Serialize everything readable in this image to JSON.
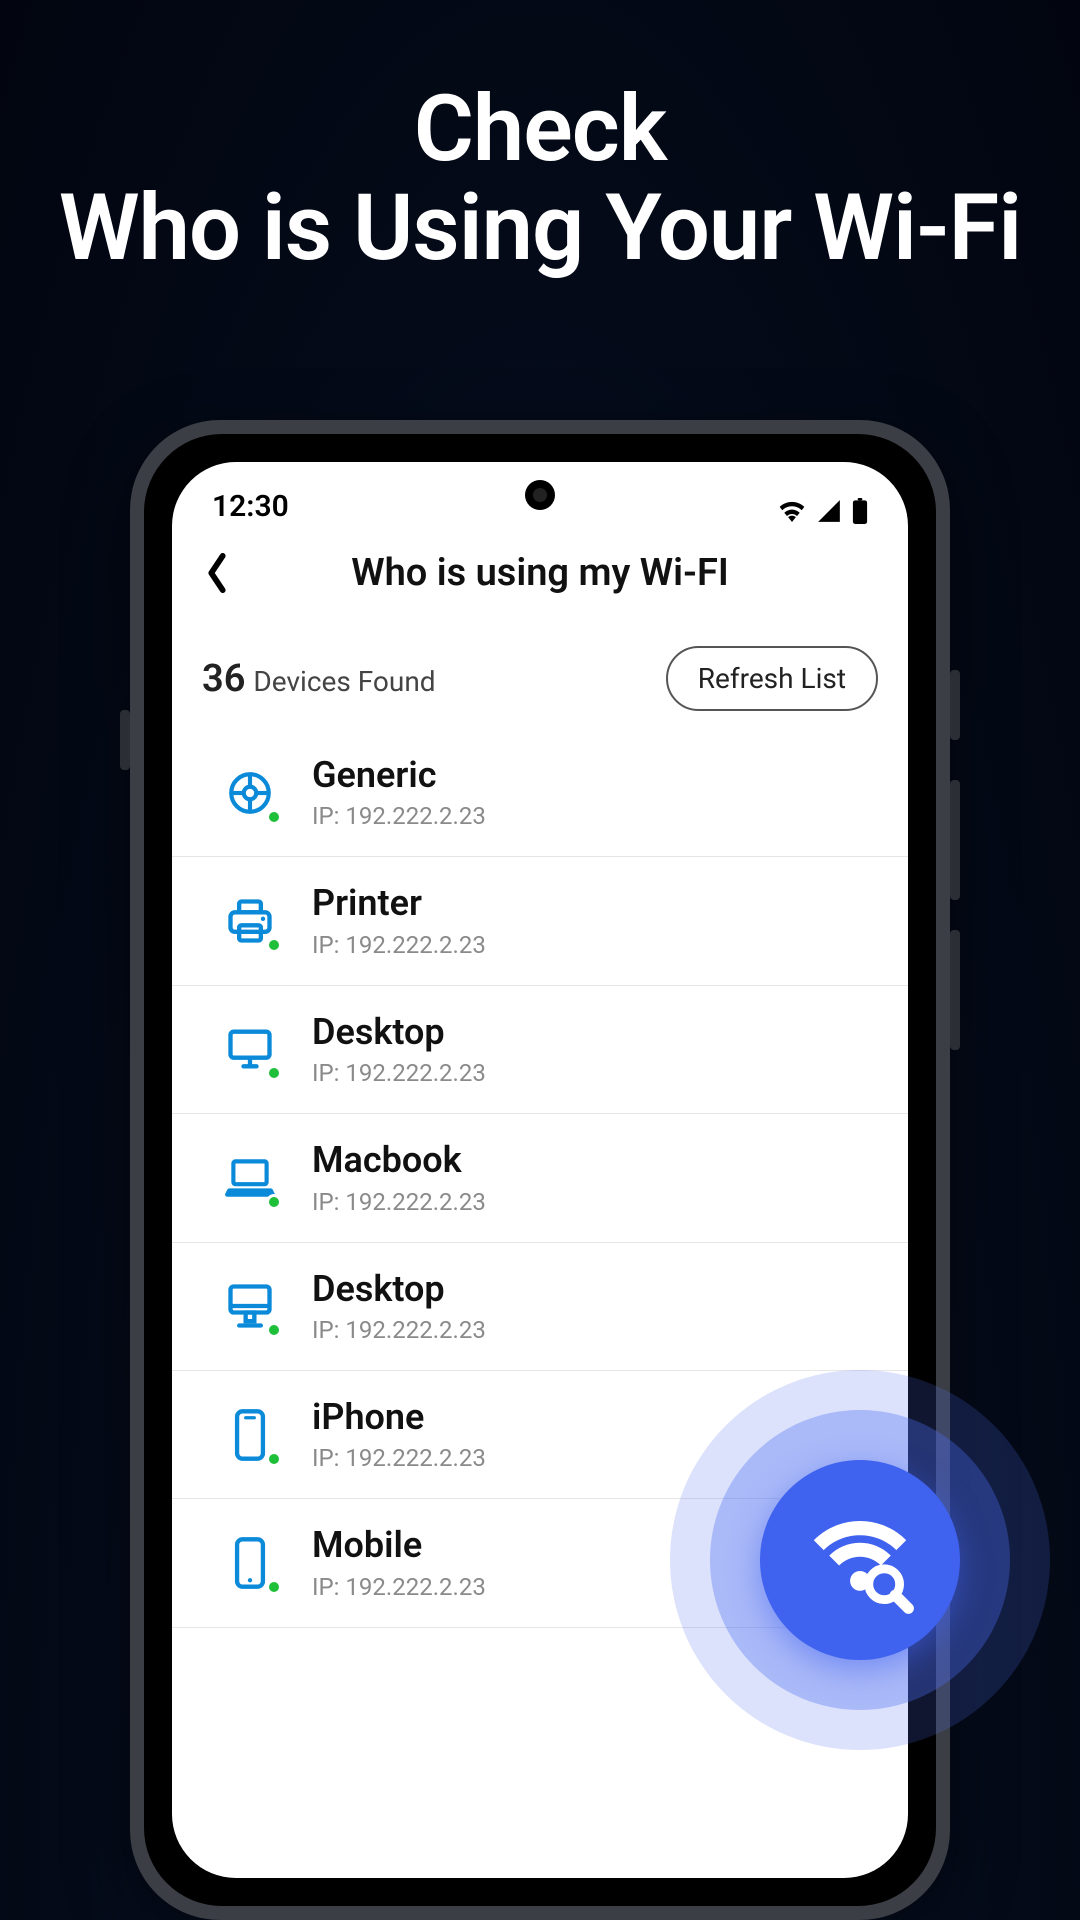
{
  "headline": {
    "line1": "Check",
    "line2": "Who is Using Your Wi-Fi"
  },
  "status": {
    "time": "12:30"
  },
  "appbar": {
    "title": "Who is using my Wi-FI"
  },
  "header": {
    "count": "36",
    "count_label": "Devices Found",
    "refresh_label": "Refresh List"
  },
  "devices": [
    {
      "type": "generic",
      "name": "Generic",
      "ip_label": "IP: 192.222.2.23"
    },
    {
      "type": "printer",
      "name": "Printer",
      "ip_label": "IP: 192.222.2.23"
    },
    {
      "type": "desktop",
      "name": "Desktop",
      "ip_label": "IP: 192.222.2.23"
    },
    {
      "type": "laptop",
      "name": "Macbook",
      "ip_label": "IP: 192.222.2.23"
    },
    {
      "type": "imac",
      "name": "Desktop",
      "ip_label": "IP: 192.222.2.23"
    },
    {
      "type": "phone",
      "name": "iPhone",
      "ip_label": "IP: 192.222.2.23"
    },
    {
      "type": "phone",
      "name": "Mobile",
      "ip_label": "IP: 192.222.2.23"
    }
  ],
  "colors": {
    "accent_blue": "#0a8ad8",
    "online_green": "#1fbf3a",
    "fab_blue": "#3f62ef"
  }
}
